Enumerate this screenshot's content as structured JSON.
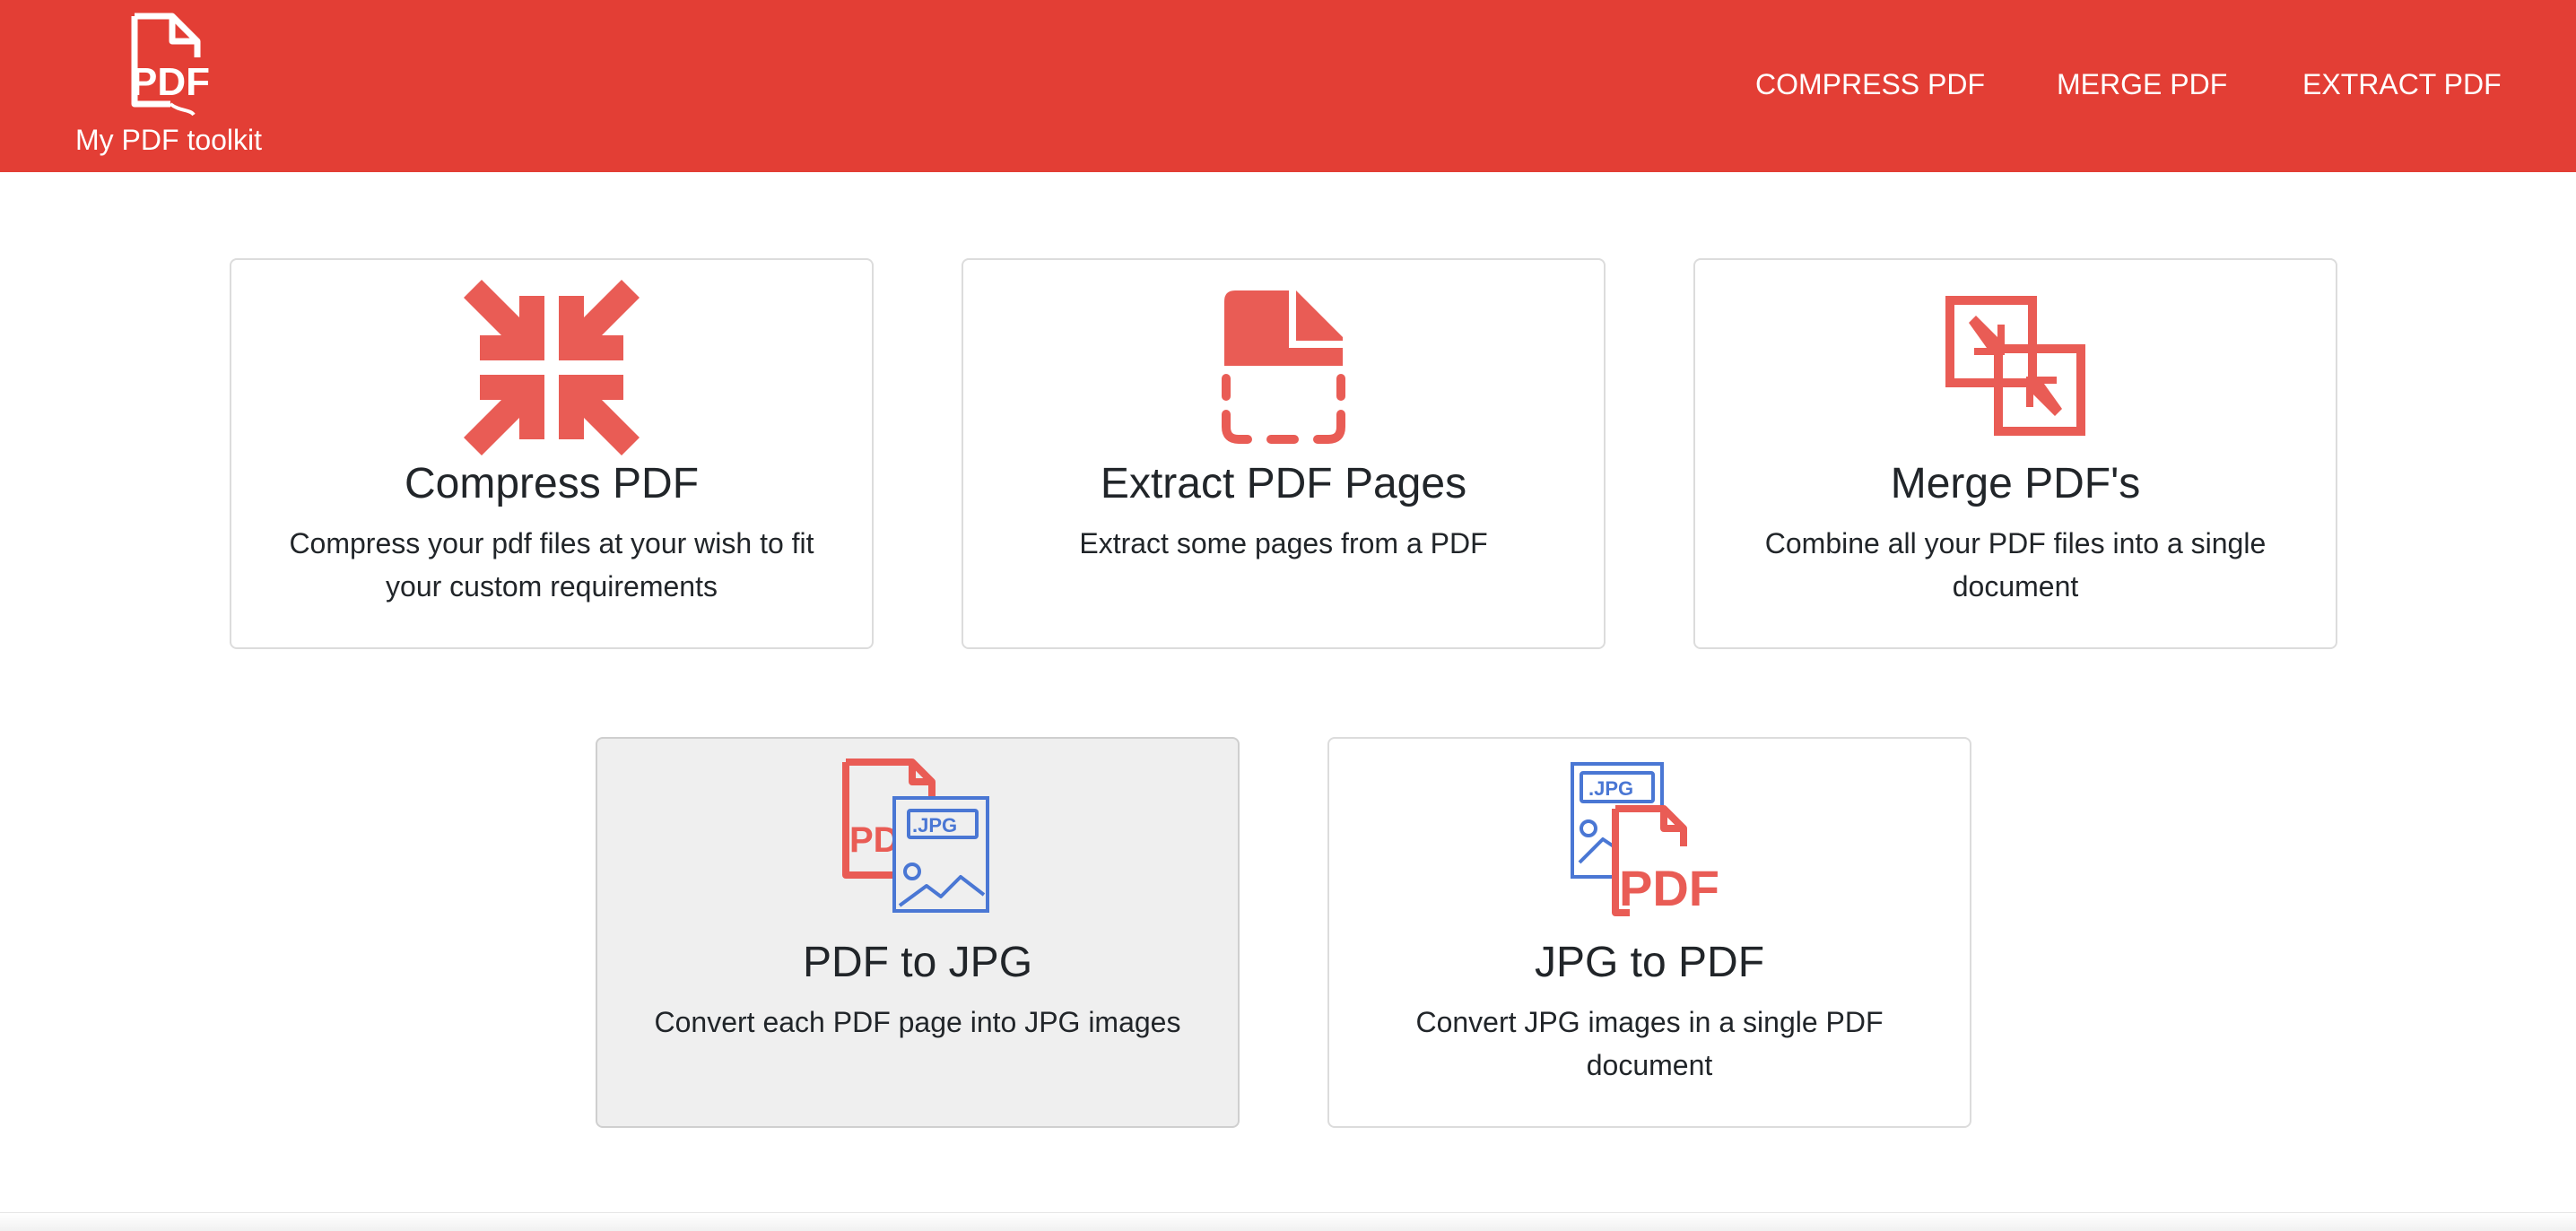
{
  "navbar": {
    "brand_logo": "pdf-file-icon",
    "brand_text": "My PDF toolkit",
    "links": [
      "COMPRESS PDF",
      "MERGE PDF",
      "EXTRACT PDF"
    ],
    "background": "#e33e35"
  },
  "cards": [
    {
      "title": "Compress PDF",
      "text": "Compress your pdf files at your wish to fit your custom requirements",
      "icon": "compress-arrows-icon"
    },
    {
      "title": "Extract PDF Pages",
      "text": "Extract some pages from a PDF",
      "icon": "extract-page-icon"
    },
    {
      "title": "Merge PDF's",
      "text": "Combine all your PDF files into a single document",
      "icon": "merge-squares-icon"
    },
    {
      "title": "PDF to JPG",
      "text": "Convert each PDF page into JPG images",
      "icon": "pdf-to-jpg-icon"
    },
    {
      "title": "JPG to PDF",
      "text": "Convert JPG images in a single PDF document",
      "icon": "jpg-to-pdf-icon"
    }
  ],
  "icon_labels": {
    "pdf": "PDF",
    "jpg": ".JPG"
  },
  "colors": {
    "accent_red": "#e95c55",
    "accent_blue": "#4a77d4"
  }
}
